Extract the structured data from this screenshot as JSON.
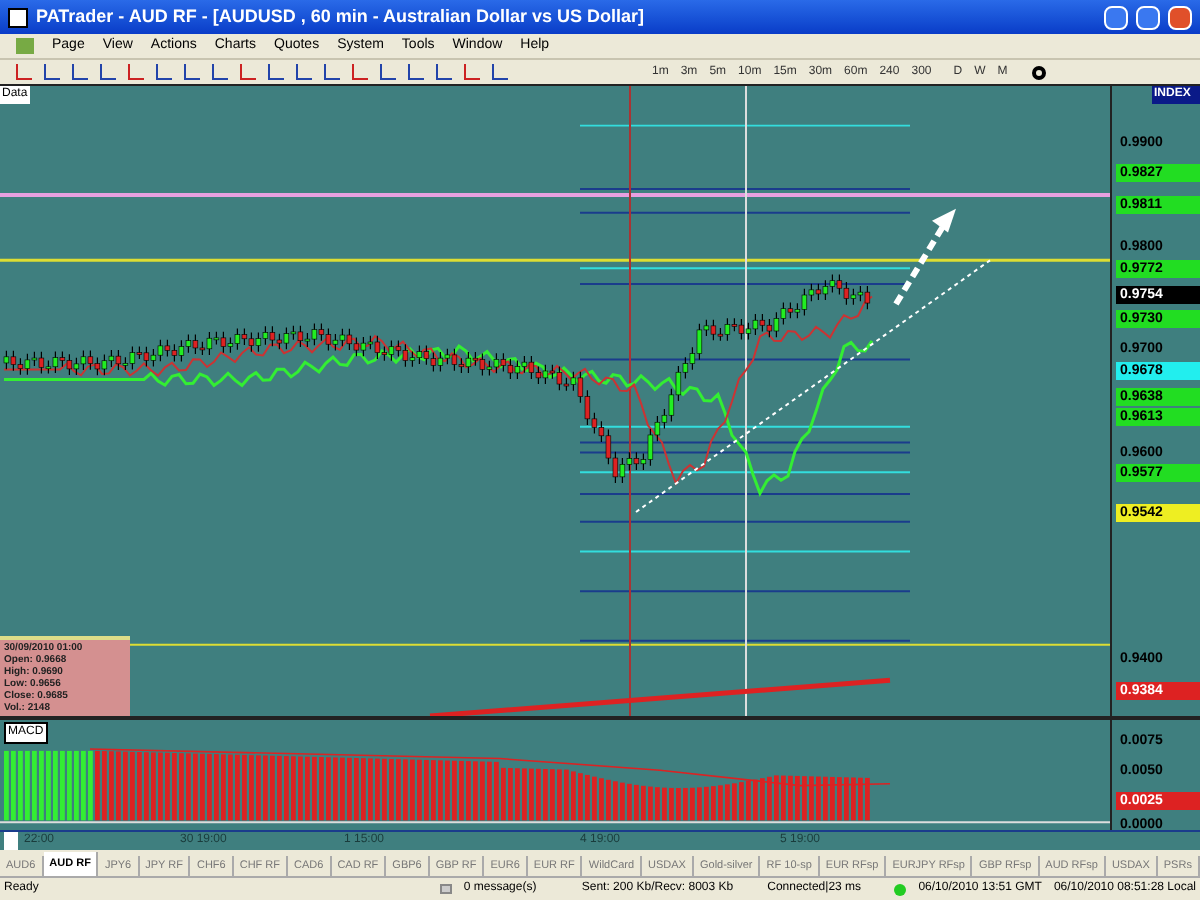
{
  "window": {
    "title": "PATrader - AUD RF - [AUDUSD , 60 min - Australian Dollar vs US Dollar]"
  },
  "menu": [
    "Page",
    "View",
    "Actions",
    "Charts",
    "Quotes",
    "System",
    "Tools",
    "Window",
    "Help"
  ],
  "timeframes": [
    "1m",
    "3m",
    "5m",
    "10m",
    "15m",
    "30m",
    "60m",
    "240",
    "300",
    "D",
    "W",
    "M"
  ],
  "chart": {
    "label": "Data",
    "index_label": "INDEX",
    "price_labels": [
      {
        "text": "0.9900"
      },
      {
        "text": "0.9827",
        "color": "#22dd22"
      },
      {
        "text": "0.9811",
        "color": "#22dd22"
      },
      {
        "text": "0.9800"
      },
      {
        "text": "0.9772",
        "color": "#22dd22"
      },
      {
        "text": "0.9754",
        "color": "#000000"
      },
      {
        "text": "0.9730",
        "color": "#22dd22"
      },
      {
        "text": "0.9700"
      },
      {
        "text": "0.9678",
        "color": "#22eeee"
      },
      {
        "text": "0.9638",
        "color": "#22dd22"
      },
      {
        "text": "0.9613",
        "color": "#22dd22"
      },
      {
        "text": "0.9600"
      },
      {
        "text": "0.9577",
        "color": "#22dd22"
      },
      {
        "text": "0.9542",
        "color": "#eeee22"
      },
      {
        "text": "0.9400"
      },
      {
        "text": "0.9384",
        "color": "#dd2222"
      }
    ],
    "info": [
      "30/09/2010 01:00",
      "Open: 0.9668",
      "High: 0.9690",
      "Low: 0.9656",
      "Close: 0.9685",
      "Vol.: 2148"
    ]
  },
  "macd": {
    "label": "MACD",
    "axis": [
      {
        "text": "0.0075"
      },
      {
        "text": "0.0050"
      },
      {
        "text": "0.0025",
        "color": "#dd2222"
      },
      {
        "text": "0.0000"
      }
    ]
  },
  "time_axis": [
    "22:00",
    "30 19:00",
    "1 15:00",
    "4 19:00",
    "5 19:00"
  ],
  "tabs": [
    {
      "label": "AUD6",
      "selected": false
    },
    {
      "label": "AUD RF",
      "selected": true
    },
    {
      "label": "JPY6",
      "selected": false
    },
    {
      "label": "JPY RF",
      "selected": false
    },
    {
      "label": "CHF6",
      "selected": false
    },
    {
      "label": "CHF RF",
      "selected": false
    },
    {
      "label": "CAD6",
      "selected": false
    },
    {
      "label": "CAD RF",
      "selected": false
    },
    {
      "label": "GBP6",
      "selected": false
    },
    {
      "label": "GBP RF",
      "selected": false
    },
    {
      "label": "EUR6",
      "selected": false
    },
    {
      "label": "EUR RF",
      "selected": false
    },
    {
      "label": "WildCard",
      "selected": false
    },
    {
      "label": "USDAX",
      "selected": false
    },
    {
      "label": "Gold-silver",
      "selected": false
    },
    {
      "label": "RF 10-sp",
      "selected": false
    },
    {
      "label": "EUR RFsp",
      "selected": false
    },
    {
      "label": "EURJPY RFsp",
      "selected": false
    },
    {
      "label": "GBP RFsp",
      "selected": false
    },
    {
      "label": "AUD RFsp",
      "selected": false
    },
    {
      "label": "USDAX",
      "selected": false
    },
    {
      "label": "PSRs",
      "selected": false
    }
  ],
  "status_bar": {
    "state": "Ready",
    "messages": "0 message(s)",
    "traffic": "Sent: 200 Kb/Recv: 8003 Kb",
    "connection": "Connected|23 ms",
    "gmt": "06/10/2010 13:51 GMT",
    "local": "06/10/2010 08:51:28 Local"
  }
}
